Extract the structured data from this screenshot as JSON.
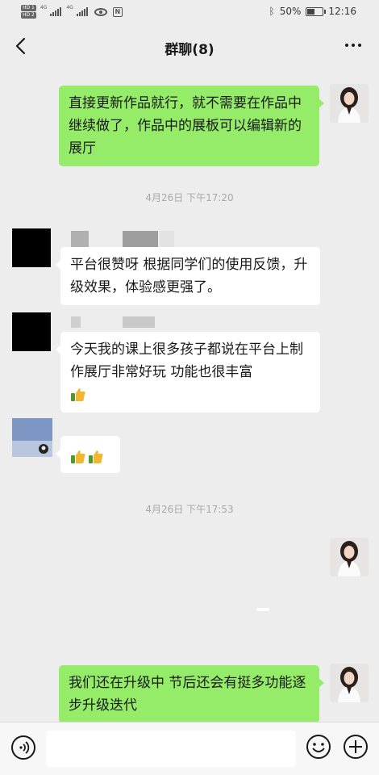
{
  "status_bar": {
    "hd1": "HD 1",
    "hd2": "HD 2",
    "net1": "4G",
    "net2": "4G",
    "battery": "50%",
    "time": "12:16",
    "battery_level": 0.5
  },
  "header": {
    "title": "群聊(8)",
    "icons": [
      "back-icon",
      "more-icon"
    ]
  },
  "messages": [
    {
      "sender": "me",
      "text": "直接更新作品就行，就不需要在作品中继续做了，作品中的展板可以编辑新的展厅"
    },
    {
      "type": "timestamp",
      "text": "4月26日 下午17:20"
    },
    {
      "sender": "other",
      "text": "平台很赞呀 根据同学们的使用反馈，升级效果，体验感更强了。"
    },
    {
      "sender": "other",
      "text": "今天我的课上很多孩子都说在平台上制作展厅非常好玩 功能也很丰富"
    },
    {
      "sender": "other",
      "sticker": "thumbs-up-x2"
    },
    {
      "type": "timestamp",
      "text": "4月26日 下午17:53"
    },
    {
      "sender": "me",
      "text": ""
    },
    {
      "sender": "me",
      "text": "我们还在升级中  节后还会有挺多功能逐步升级迭代"
    }
  ],
  "input_bar": {
    "placeholder": "",
    "icons": [
      "voice-icon",
      "emoji-icon",
      "plus-icon"
    ]
  },
  "colors": {
    "background": "#ededed",
    "my_bubble": "#95ec69",
    "other_bubble": "#ffffff",
    "timestamp": "#a8a8a8"
  }
}
